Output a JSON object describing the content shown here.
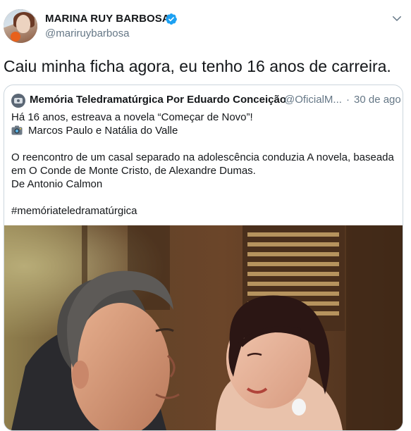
{
  "tweet": {
    "author": {
      "display_name": "MARINA RUY BARBOSA",
      "handle": "@mariruybarbosa",
      "verified": true
    },
    "text": "Caiu minha ficha agora, eu tenho 16 anos de carreira.",
    "quoted": {
      "author_name": "Memória Teledramatúrgica Por Eduardo Conceição",
      "handle": "@OficialM...",
      "separator": "·",
      "date": "30 de ago",
      "lines": {
        "l1": "Há 16 anos, estreava a novela “Começar de Novo”!",
        "l2": "Marcos Paulo e Natália do Valle",
        "l3": "O reencontro de um casal separado na adolescência conduzia A novela, baseada",
        "l4": "em O Conde de Monte Cristo, de Alexandre Dumas.",
        "l5": "De Antonio Calmon",
        "l6": "#memóriateledramatúrgica"
      },
      "media": {
        "icon": "camera-emoji-icon"
      }
    }
  },
  "icons": {
    "verified": "verified-badge-icon",
    "menu": "chevron-down-icon"
  },
  "colors": {
    "verified": "#1da1f2",
    "secondary_text": "#657786",
    "border": "#ccd6dd"
  }
}
